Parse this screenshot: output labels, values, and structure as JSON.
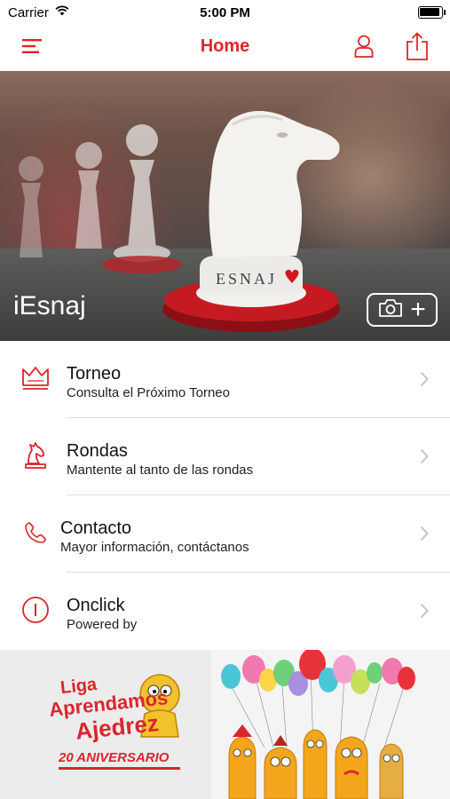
{
  "status": {
    "carrier": "Carrier",
    "time": "5:00 PM",
    "battery": 0.95
  },
  "nav": {
    "title": "Home",
    "menu_icon": "menu-icon",
    "user_icon": "user-icon",
    "share_icon": "share-icon"
  },
  "hero": {
    "caption": "iEsnaj",
    "piece_text": "ESNAJ",
    "camera_icon": "camera-icon",
    "plus_symbol": "+"
  },
  "menu": [
    {
      "title": "Torneo",
      "subtitle": "Consulta el Próximo Torneo",
      "icon": "crown-icon"
    },
    {
      "title": "Rondas",
      "subtitle": "Mantente al tanto de las rondas",
      "icon": "knight-icon"
    },
    {
      "title": "Contacto",
      "subtitle": "Mayor información, contáctanos",
      "icon": "phone-icon"
    },
    {
      "title": "Onclick",
      "subtitle": "Powered by",
      "icon": "info-icon"
    }
  ],
  "banner": {
    "liga": "Liga",
    "aprendamos": "Aprendamos",
    "ajedrez": "Ajedrez",
    "aniversario": "20 ANIVERSARIO"
  },
  "colors": {
    "accent": "#e0242b"
  }
}
